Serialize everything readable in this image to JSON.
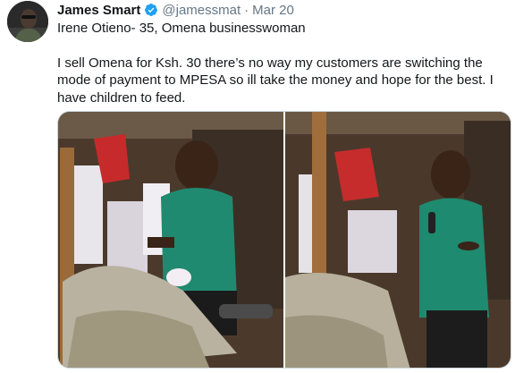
{
  "tweet": {
    "author_name": "James Smart",
    "handle": "@jamessmat",
    "separator": "·",
    "date": "Mar 20",
    "line1": "Irene Otieno- 35, Omena businesswoman",
    "line2": "I sell Omena for Ksh. 30 there’s no way my customers are switching the mode of payment to MPESA so ill take the money and hope for the best. I have children to feed."
  },
  "colors": {
    "verified_badge": "#1da1f2",
    "secondary_text": "#657786",
    "primary_text": "#14171a"
  },
  "icons": {
    "verified": "verified-badge-icon"
  }
}
